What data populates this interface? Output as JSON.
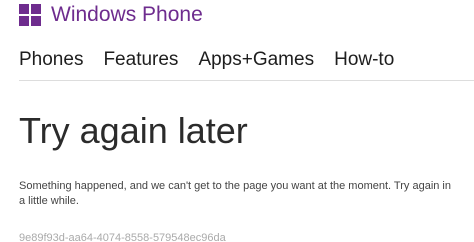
{
  "brand": {
    "name": "Windows Phone",
    "logo_colors": [
      "#6e2c8e",
      "#6e2c8e",
      "#6e2c8e",
      "#6e2c8e"
    ]
  },
  "nav": {
    "items": [
      {
        "label": "Phones"
      },
      {
        "label": "Features"
      },
      {
        "label": "Apps+Games"
      },
      {
        "label": "How-to"
      }
    ]
  },
  "error": {
    "title": "Try again later",
    "message": "Something happened, and we can't get to the page you want at the moment. Try again in a little while.",
    "id": "9e89f93d-aa64-4074-8558-579548ec96da"
  },
  "colors": {
    "brand_purple": "#6e2c8e",
    "text_dark": "#1e1e1e"
  }
}
